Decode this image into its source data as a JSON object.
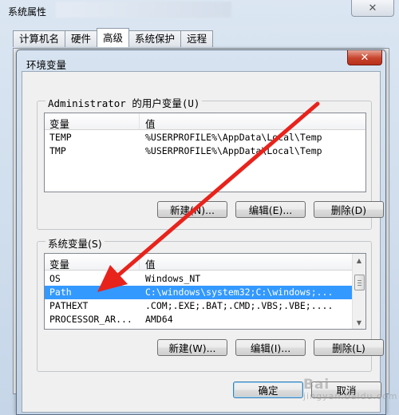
{
  "outer_window": {
    "title": "系统属性",
    "close_glyph": "✕",
    "tabs": [
      {
        "label": "计算机名",
        "active": false
      },
      {
        "label": "硬件",
        "active": false
      },
      {
        "label": "高级",
        "active": true
      },
      {
        "label": "系统保护",
        "active": false
      },
      {
        "label": "远程",
        "active": false
      }
    ]
  },
  "dialog": {
    "title": "环境变量",
    "close_glyph": "✕",
    "user_vars": {
      "label": "Administrator 的用户变量(U)",
      "col_name": "变量",
      "col_value": "值",
      "rows": [
        {
          "name": "TEMP",
          "value": "%USERPROFILE%\\AppData\\Local\\Temp"
        },
        {
          "name": "TMP",
          "value": "%USERPROFILE%\\AppData\\Local\\Temp"
        }
      ],
      "buttons": {
        "new": "新建(N)...",
        "edit": "编辑(E)...",
        "delete": "删除(D)"
      }
    },
    "system_vars": {
      "label": "系统变量(S)",
      "col_name": "变量",
      "col_value": "值",
      "rows": [
        {
          "name": "OS",
          "value": "Windows_NT",
          "selected": false
        },
        {
          "name": "Path",
          "value": "C:\\windows\\system32;C:\\windows;...",
          "selected": true
        },
        {
          "name": "PATHEXT",
          "value": ".COM;.EXE;.BAT;.CMD;.VBS;.VBE;....",
          "selected": false
        },
        {
          "name": "PROCESSOR_AR...",
          "value": "AMD64",
          "selected": false
        }
      ],
      "buttons": {
        "new": "新建(W)...",
        "edit": "编辑(I)...",
        "delete": "删除(L)"
      }
    },
    "footer": {
      "ok": "确定",
      "cancel": "取消"
    }
  },
  "annotation": {
    "arrow_color": "#e8231c"
  },
  "watermark": {
    "text": "Bai",
    "sub": "jingyan.baidu.com"
  },
  "colors": {
    "selection": "#3399ff",
    "close_red": "#c7432c"
  }
}
